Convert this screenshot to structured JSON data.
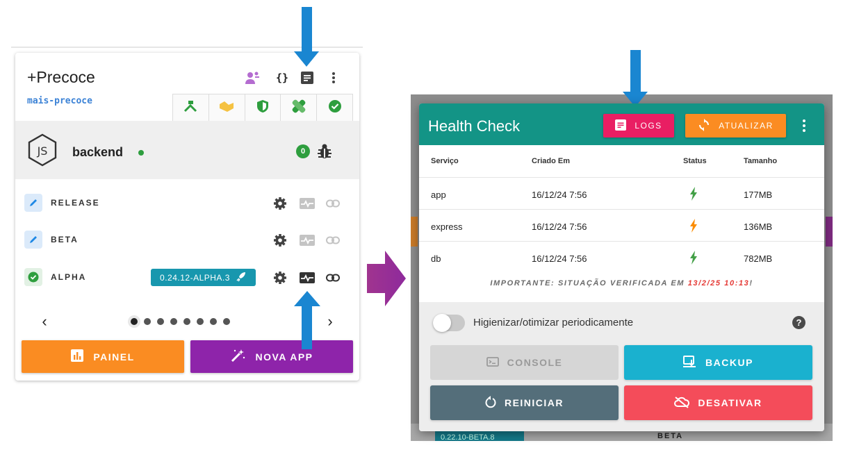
{
  "app_card": {
    "title": "+Precoce",
    "slug": "mais-precoce",
    "header_icons": [
      "team-icon",
      "code-braces-icon",
      "document-icon",
      "more-vert-icon"
    ],
    "tab_icons": [
      "tools-icon",
      "handshake-icon",
      "shield-icon",
      "bandage-icon",
      "verified-icon"
    ],
    "backend": {
      "logo": "nodejs-icon",
      "name": "backend",
      "status_color": "#2e9e3e",
      "issue_count": "0"
    },
    "environments": [
      {
        "label": "RELEASE",
        "icon": "pencil-icon",
        "version": ""
      },
      {
        "label": "BETA",
        "icon": "pencil-icon",
        "version": ""
      },
      {
        "label": "ALPHA",
        "icon": "check-badge-icon",
        "version": "0.24.12-ALPHA.3"
      }
    ],
    "pager": {
      "pages": 8,
      "current": 1
    },
    "buttons": {
      "panel": "PAINEL",
      "new_app": "NOVA APP"
    },
    "colors": {
      "panel": "#fa8c22",
      "new_app": "#8e24aa",
      "version_chip": "#1897ae"
    }
  },
  "health_check": {
    "title": "Health Check",
    "logs_label": "LOGS",
    "refresh_label": "ATUALIZAR",
    "columns": [
      "Serviço",
      "Criado Em",
      "Status",
      "Tamanho"
    ],
    "rows": [
      {
        "service": "app",
        "created": "16/12/24 7:56",
        "status_color": "#43a047",
        "size": "177MB"
      },
      {
        "service": "express",
        "created": "16/12/24 7:56",
        "status_color": "#fb8c00",
        "size": "136MB"
      },
      {
        "service": "db",
        "created": "16/12/24 7:56",
        "status_color": "#43a047",
        "size": "782MB"
      }
    ],
    "notice_prefix": "IMPORTANTE",
    "notice_text": ": SITUAÇÃO VERIFICADA EM ",
    "notice_date": "13/2/25 10:13",
    "notice_suffix": "!",
    "toggle_label": "Higienizar/otimizar periodicamente",
    "toggle_on": false,
    "buttons": {
      "console": "CONSOLE",
      "backup": "BACKUP",
      "restart": "REINICIAR",
      "disable": "DESATIVAR"
    },
    "colors": {
      "header": "#139486",
      "logs": "#e91e63",
      "refresh": "#fb8c22",
      "backup": "#1ab1cf",
      "restart": "#546e7a",
      "disable": "#f44c5a",
      "console_disabled": "#d6d6d6"
    }
  },
  "background": {
    "version_chip": "0.22.10-BETA.8",
    "env_label": "BETA"
  }
}
